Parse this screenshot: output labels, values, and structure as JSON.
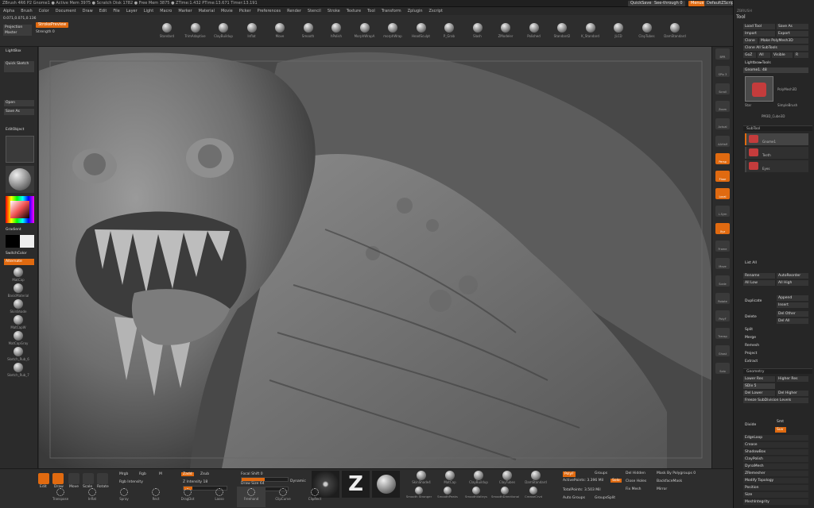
{
  "titlebar": {
    "text": "ZBrush 4R6 P2   Gnome1   ● Active Mem 3975 ● Scratch Disk 1782 ● Free Mem 3875 ● ZTime:1.432 PTime:13.671 Timer:13.191"
  },
  "menu": [
    "Alpha",
    "Brush",
    "Color",
    "Document",
    "Draw",
    "Edit",
    "File",
    "Layer",
    "Light",
    "Macro",
    "Marker",
    "Material",
    "Movie",
    "Picker",
    "Preferences",
    "Render",
    "Stencil",
    "Stroke",
    "Texture",
    "Tool",
    "Transform",
    "Zplugin",
    "Zscript"
  ],
  "top_right": {
    "quicksave": "QuickSave",
    "see_through": "See-through 0",
    "menus": "Menus",
    "default_script": "DefaultZScript"
  },
  "coords": "0.071,0.071,0.136",
  "top_left": {
    "projection": "Projection Master",
    "lightbox": "LightBox",
    "quick_sketch": "Quick Sketch",
    "stroke_preview": "StrokePreview",
    "strength": "Strength 0"
  },
  "brushes": [
    "Standard",
    "TrimAdaptive",
    "ClayBuildup",
    "Inflat",
    "Move",
    "Smooth",
    "hPolish",
    "MorphWrapA",
    "morphWrap",
    "HeadSculpt",
    "P_Grab",
    "Slash",
    "ZModeler",
    "Polished",
    "Standard2",
    "K_Standard",
    "JLCD",
    "ClayTubes",
    "DamStandard"
  ],
  "left": {
    "open": "Open",
    "save_as": "Save As",
    "lightbox": "LightBox",
    "quick_sketch": "Quick Sketch",
    "edit_object": "EditObject",
    "gradient": "Gradient",
    "switch_color": "SwitchColor",
    "alternate": "Alternate",
    "materials": [
      "MatCap",
      "BasicMaterial",
      "SkinShade",
      "MatCapW",
      "MatCapGray",
      "Sketch_Rub_6",
      "Sketch_Rub_7"
    ]
  },
  "right_nav": [
    "BPR",
    "SPix 3",
    "Scroll",
    "Zoom",
    "Actual",
    "AAHalf",
    "Persp",
    "Floor",
    "Local",
    "L.Sym",
    "Xyz",
    "Frame",
    "Move",
    "Scale",
    "Rotate",
    "PolyF",
    "Transp",
    "Ghost",
    "Solo"
  ],
  "tool_panel": {
    "title": "Tool",
    "load_tool": "Load Tool",
    "save_as": "Save As",
    "import": "Import",
    "export": "Export",
    "clone": "Clone",
    "make_polymesh": "Make PolyMesh3D",
    "clone_all": "Clone All SubTools",
    "goz": "GoZ",
    "all": "All",
    "visible": "Visible",
    "r": "R",
    "lightbox_tools": "Lightbox▸Tools",
    "gnome_label": "Gnome1. 48",
    "tool_thumbs": [
      "Gnome1",
      "PolyMesh3D",
      "Star",
      "SimpleBrush",
      "PM3D_Cube3D"
    ],
    "subtool_header": "SubTool",
    "subtools": [
      "Gnome1",
      "Teeth",
      "Eyes"
    ],
    "list_all": "List All",
    "rename": "Rename",
    "autoreorder": "AutoReorder",
    "all_low": "All Low",
    "all_high": "All High",
    "duplicate": "Duplicate",
    "append": "Append",
    "insert": "Insert",
    "delete": "Delete",
    "del_other": "Del Other",
    "del_all": "Del All",
    "split": "Split",
    "merge": "Merge",
    "remesh": "Remesh",
    "project": "Project",
    "extract": "Extract",
    "geometry_header": "Geometry",
    "lower_res": "Lower Res",
    "higher_res": "Higher Res",
    "sdiv": "SDiv 5",
    "del_lower": "Del Lower",
    "del_higher": "Del Higher",
    "freeze": "Freeze SubDivision Levels",
    "divide": "Divide",
    "smt": "Smt",
    "suv": "Suv",
    "edgeloop": "EdgeLoop",
    "crease": "Crease",
    "shadowbox": "ShadowBox",
    "claypolish": "ClayPolish",
    "dynamesh": "DynaMesh",
    "zremesher": "ZRemesher",
    "modify_topology": "Modify Topology",
    "position": "Position",
    "size": "Size",
    "mesh_integrity": "MeshIntegrity"
  },
  "bottom": {
    "edit": "Edit",
    "draw": "Draw",
    "move": "Move",
    "scale": "Scale",
    "rotate": "Rotate",
    "mrgb": "Mrgb",
    "rgb": "Rgb",
    "m": "M",
    "zadd": "Zadd",
    "zsub": "Zsub",
    "rgb_intensity": "Rgb Intensity",
    "z_intensity": "Z Intensity 18",
    "focal_shift": "Focal Shift 0",
    "draw_size": "Draw Size 64",
    "dynamic": "Dynamic",
    "brush_icons": [
      "Standard",
      "DragRect",
      "Alpha Off"
    ],
    "mat_row": [
      "SkinShade4",
      "MatCap",
      "ClayBuildup",
      "ClayTubes",
      "DamStandard"
    ],
    "mat_row2": [
      "Smooth Stronger",
      "SmoothPeaks",
      "SmoothValleys",
      "SmoothDirectional",
      "CreaseCrvd"
    ],
    "active_points": "ActivePoints: 3.396 Mil",
    "total_points": "TotalPoints: 3.503 Mil",
    "polyframe": "PolyF",
    "groups": "Groups",
    "solo": "Solo",
    "hidden": "Del Hidden",
    "mask_by_polygroups": "Mask By Polygroups 0",
    "close_holes": "Close Holes",
    "backfacemask": "BackfaceMask",
    "fix_mesh": "Fix Mesh",
    "mirror": "Mirror",
    "auto_groups": "Auto Groups",
    "groups_split": "GroupsSplit",
    "tool_icons": [
      "Transpose",
      "Inflat",
      "Spray",
      "Rect",
      "DragDot",
      "Lasso",
      "Freehand",
      "ClipCurve",
      "ClipRect"
    ]
  },
  "colors": {
    "accent": "#e06a10",
    "panel": "#2b2b2b",
    "canvas": "#454545"
  }
}
